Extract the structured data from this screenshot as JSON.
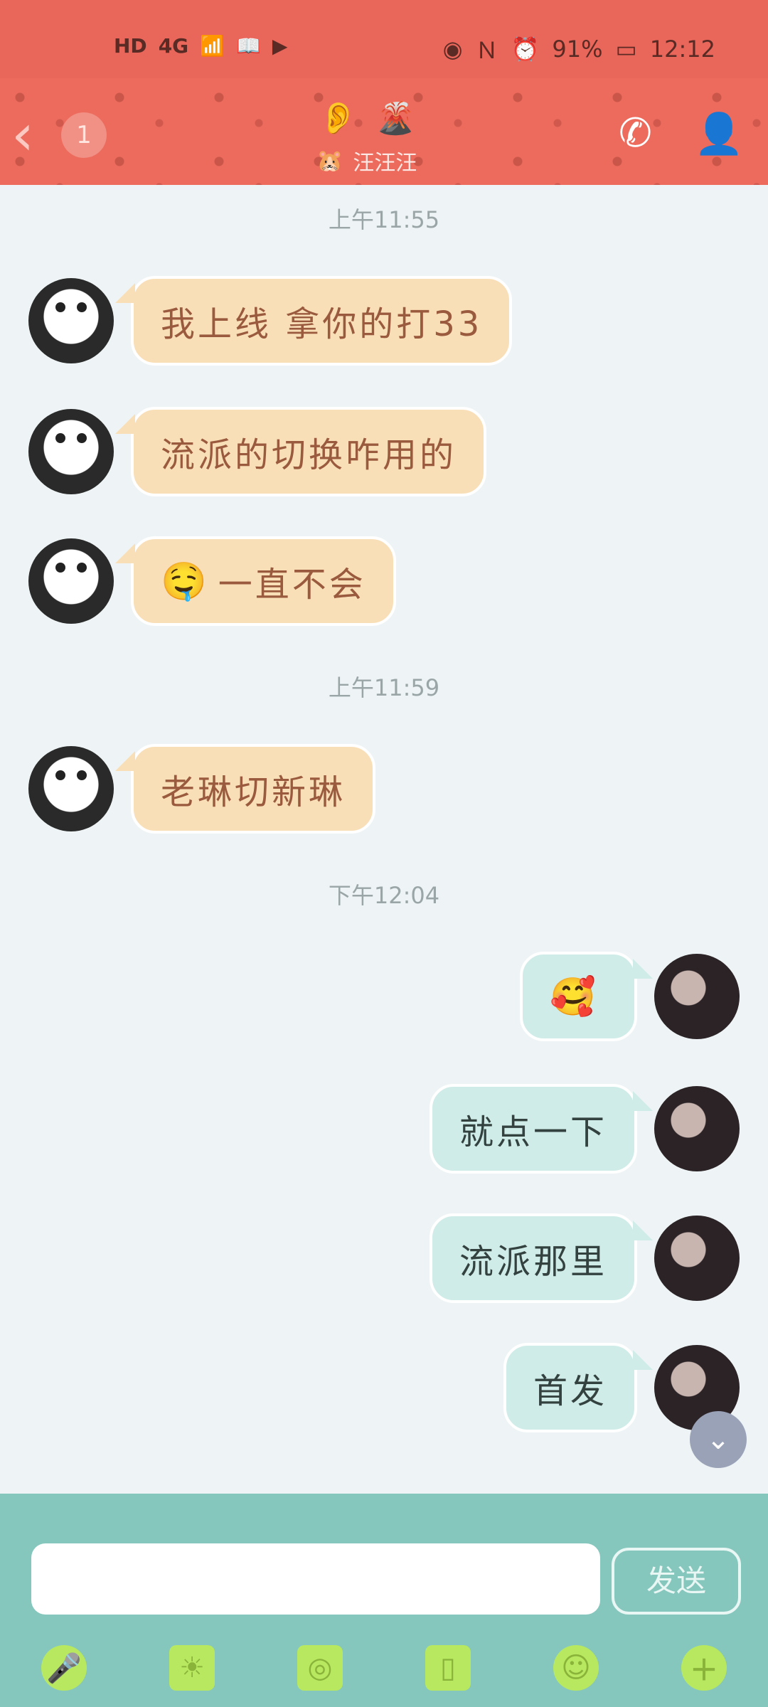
{
  "status_bar": {
    "left_labels": [
      "HD",
      "4G",
      "📶",
      "📖",
      "▶"
    ],
    "battery_percent": "91%",
    "time": "12:12"
  },
  "chat_header": {
    "back_count": "1",
    "contact_name": "汪汪汪",
    "icons": [
      "ear-icon",
      "volcano-icon",
      "hamster-icon",
      "call-icon",
      "profile-icon"
    ]
  },
  "messages": [
    {
      "type": "time",
      "text": "上午11:55"
    },
    {
      "type": "in",
      "text": "我上线 拿你的打33"
    },
    {
      "type": "in",
      "text": "流派的切换咋用的"
    },
    {
      "type": "in",
      "emoji": "🤤",
      "text": "一直不会"
    },
    {
      "type": "time",
      "text": "上午11:59"
    },
    {
      "type": "in",
      "text": "老琳切新琳"
    },
    {
      "type": "time",
      "text": "下午12:04"
    },
    {
      "type": "out",
      "emoji": "🥰",
      "text": ""
    },
    {
      "type": "out",
      "text": "就点一下"
    },
    {
      "type": "out",
      "text": "流派那里"
    },
    {
      "type": "out",
      "text": "首发"
    }
  ],
  "composer": {
    "input_placeholder": "",
    "send_label": "发送"
  },
  "toolbar_icons": [
    "microphone-icon",
    "image-icon",
    "camera-icon",
    "file-icon",
    "emoji-icon",
    "plus-icon"
  ],
  "colors": {
    "header": "#ec6b5d",
    "incoming_bubble": "#f9dfb8",
    "outgoing_bubble": "#cfece8",
    "bottom_bar": "#86c7bd"
  }
}
